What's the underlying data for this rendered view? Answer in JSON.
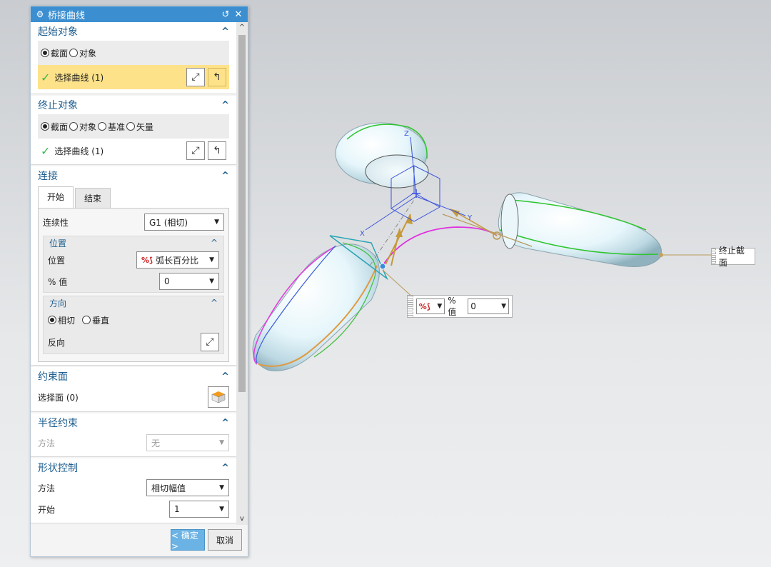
{
  "dialog": {
    "title": "桥接曲线",
    "start_obj": {
      "header": "起始对象",
      "radio_section": "截面",
      "radio_object": "对象",
      "select_label": "选择曲线 (1)"
    },
    "end_obj": {
      "header": "终止对象",
      "radio_section": "截面",
      "radio_object": "对象",
      "radio_datum": "基准",
      "radio_vector": "矢量",
      "select_label": "选择曲线 (1)"
    },
    "connect": {
      "header": "连接",
      "tab_start": "开始",
      "tab_end": "结束",
      "continuity_label": "连续性",
      "continuity_value": "G1 (相切)",
      "position": {
        "header": "位置",
        "label": "位置",
        "value": "弧长百分比",
        "pct_label": "% 值",
        "pct_value": "0"
      },
      "direction": {
        "header": "方向",
        "radio_tangent": "相切",
        "radio_normal": "垂直",
        "reverse_label": "反向"
      }
    },
    "constraint_face": {
      "header": "约束面",
      "select_label": "选择面 (0)"
    },
    "radius": {
      "header": "半径约束",
      "method_label": "方法",
      "method_value": "无"
    },
    "shape": {
      "header": "形状控制",
      "method_label": "方法",
      "method_value": "相切幅值",
      "start_label": "开始",
      "start_value": "1"
    },
    "ok_label": "< 确定 >",
    "cancel_label": "取消"
  },
  "viewport": {
    "end_label": "终止截面",
    "float_pct_label": "% 值",
    "float_pct_value": "0",
    "axis_x": "X",
    "axis_y": "Y",
    "axis_z": "Z"
  }
}
